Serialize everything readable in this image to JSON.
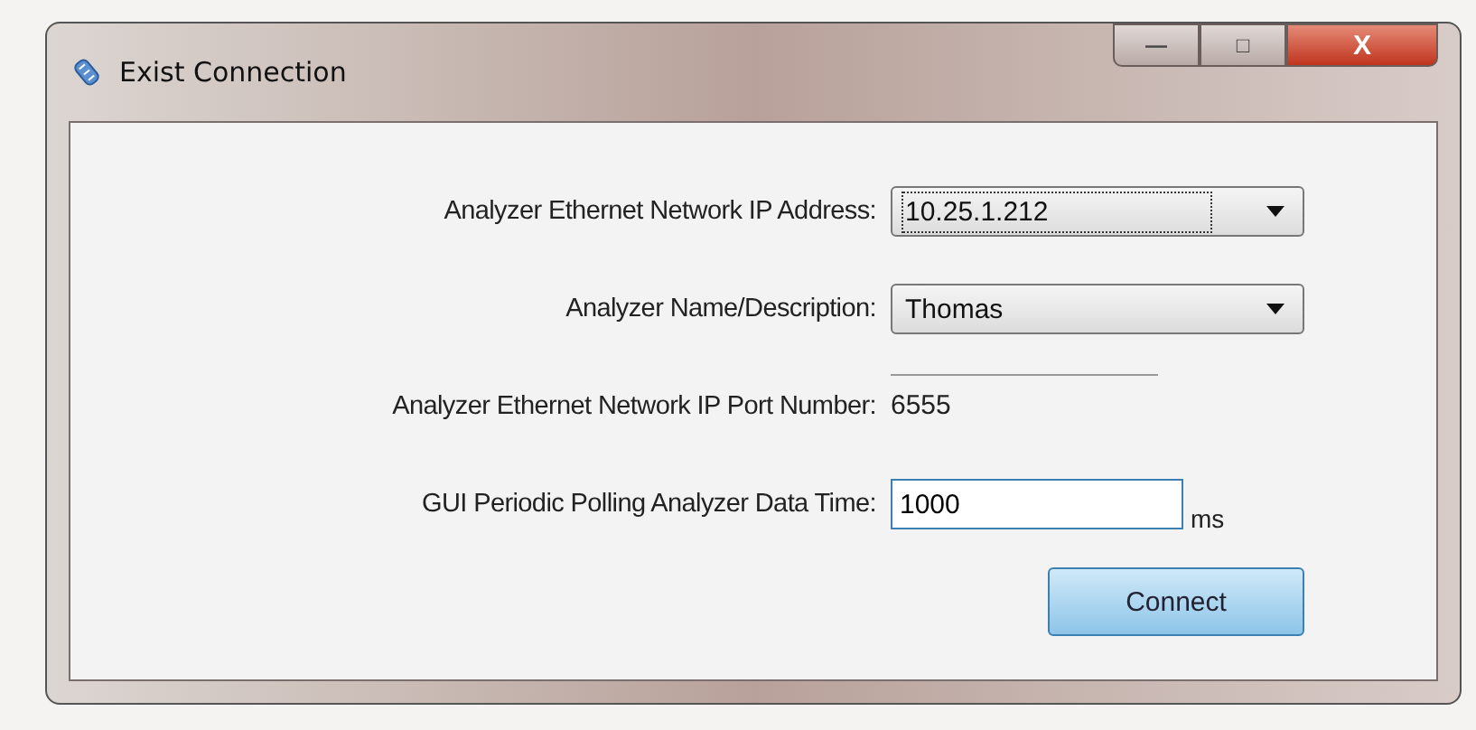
{
  "window": {
    "title": "Exist Connection",
    "controls": [
      "—",
      "□",
      "X"
    ]
  },
  "rows": [
    {
      "label": "Analyzer Ethernet Network IP Address:",
      "kind": "combo",
      "value": "10.25.1.212",
      "focused": true
    },
    {
      "label": "Analyzer Name/Description:",
      "kind": "combo",
      "value": "Thomas",
      "focused": false
    },
    {
      "label": "Analyzer Ethernet Network IP Port Number:",
      "kind": "text",
      "value": "6555"
    },
    {
      "label": "GUI Periodic Polling Analyzer Data Time:",
      "kind": "input",
      "value": "1000",
      "unit": "ms"
    }
  ],
  "button": "Connect"
}
